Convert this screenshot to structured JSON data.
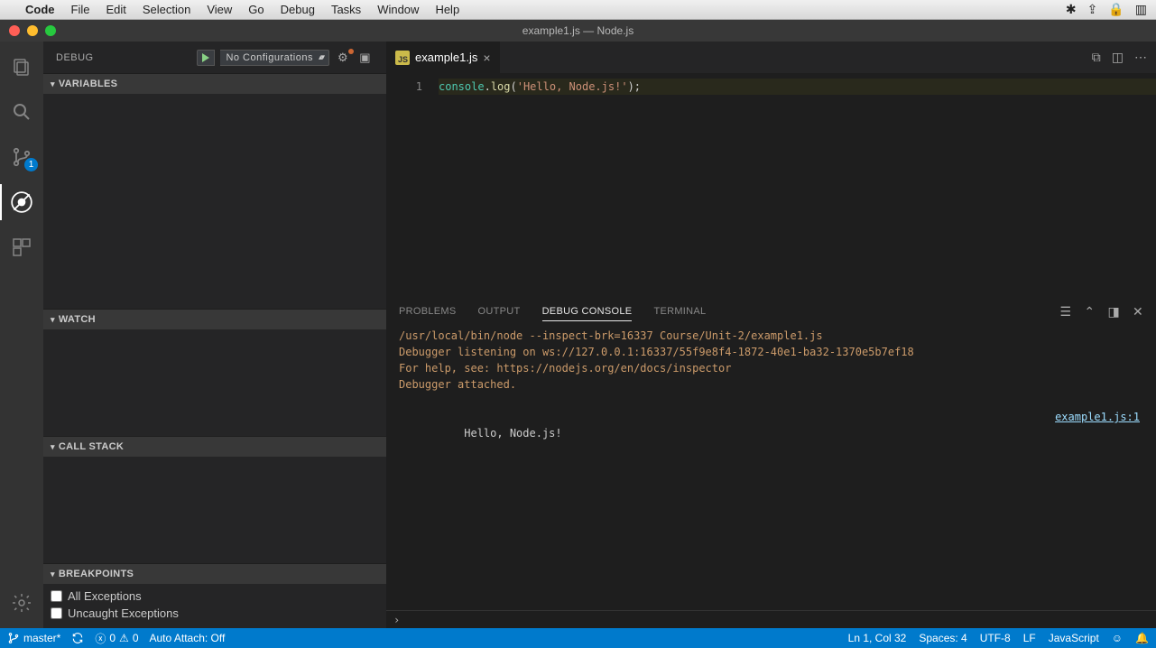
{
  "menubar": {
    "items": [
      "Code",
      "File",
      "Edit",
      "Selection",
      "View",
      "Go",
      "Debug",
      "Tasks",
      "Window",
      "Help"
    ]
  },
  "window": {
    "title": "example1.js — Node.js"
  },
  "activity": {
    "scm_badge": "1"
  },
  "sidebar": {
    "title": "DEBUG",
    "config": "No Configurations",
    "sections": {
      "variables": "VARIABLES",
      "watch": "WATCH",
      "callstack": "CALL STACK",
      "breakpoints": "BREAKPOINTS"
    },
    "breakpoints": [
      {
        "label": "All Exceptions",
        "checked": false
      },
      {
        "label": "Uncaught Exceptions",
        "checked": false
      }
    ]
  },
  "editor": {
    "tab": {
      "icon": "JS",
      "name": "example1.js"
    },
    "lineno": "1",
    "code": {
      "obj": "console",
      "dot": ".",
      "func": "log",
      "open": "(",
      "str": "'Hello, Node.js!'",
      "close": ");"
    }
  },
  "panel": {
    "tabs": {
      "problems": "PROBLEMS",
      "output": "OUTPUT",
      "debug": "DEBUG CONSOLE",
      "terminal": "TERMINAL"
    },
    "lines": [
      {
        "text": "/usr/local/bin/node --inspect-brk=16337 Course/Unit-2/example1.js",
        "cls": ""
      },
      {
        "text": "Debugger listening on ws://127.0.0.1:16337/55f9e8f4-1872-40e1-ba32-1370e5b7ef18",
        "cls": ""
      },
      {
        "text": "For help, see: https://nodejs.org/en/docs/inspector",
        "cls": ""
      },
      {
        "text": "Debugger attached.",
        "cls": ""
      },
      {
        "text": "Hello, Node.js!",
        "cls": "white",
        "src": "example1.js:1"
      }
    ],
    "repl_prompt": "›"
  },
  "status": {
    "branch": "master*",
    "errors": "0",
    "warnings": "0",
    "auto_attach": "Auto Attach: Off",
    "position": "Ln 1, Col 32",
    "spaces": "Spaces: 4",
    "encoding": "UTF-8",
    "eol": "LF",
    "language": "JavaScript"
  }
}
